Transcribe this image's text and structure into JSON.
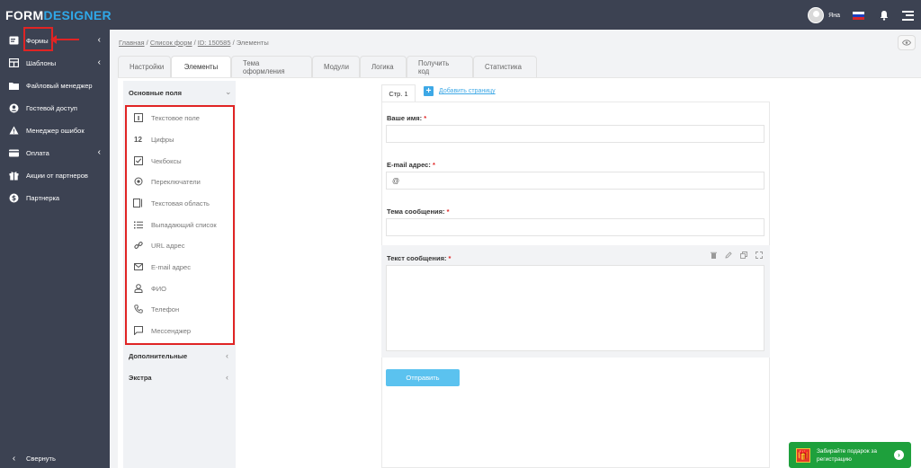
{
  "brand": {
    "logo_part1": "FORM",
    "logo_part2": "DESIGNER"
  },
  "header": {
    "username": "Яна",
    "flag_colors": [
      "#ffffff",
      "#1d3fbf",
      "#d8262b"
    ]
  },
  "sidebar": {
    "items": [
      {
        "label": "Формы",
        "icon": "forms-icon",
        "has_chevron": true
      },
      {
        "label": "Шаблоны",
        "icon": "templates-icon",
        "has_chevron": true
      },
      {
        "label": "Файловый менеджер",
        "icon": "folder-icon",
        "has_chevron": false
      },
      {
        "label": "Гостевой доступ",
        "icon": "user-circle-icon",
        "has_chevron": false
      },
      {
        "label": "Менеджер ошибок",
        "icon": "warning-icon",
        "has_chevron": false
      },
      {
        "label": "Оплата",
        "icon": "wallet-icon",
        "has_chevron": true
      },
      {
        "label": "Акции от партнеров",
        "icon": "gift-icon",
        "has_chevron": false
      },
      {
        "label": "Партнерка",
        "icon": "dollar-icon",
        "has_chevron": false
      }
    ],
    "collapse_label": "Свернуть"
  },
  "breadcrumb": {
    "home": "Главная",
    "sep1": " / ",
    "forms": "Список форм",
    "sep2": " / ",
    "id": "ID: 150585",
    "sep3": " / ",
    "current": "Элементы"
  },
  "tabs": [
    "Настройки",
    "Элементы",
    "Тема оформления",
    "Модули",
    "Логика",
    "Получить код",
    "Статистика"
  ],
  "palette": {
    "main_section": "Основные поля",
    "fields": [
      {
        "label": "Текстовое поле",
        "icon": "text-field-icon"
      },
      {
        "label": "Цифры",
        "icon": "numbers-icon",
        "glyph": "12"
      },
      {
        "label": "Чекбоксы",
        "icon": "checkbox-icon"
      },
      {
        "label": "Переключатели",
        "icon": "radio-icon"
      },
      {
        "label": "Текстовая область",
        "icon": "textarea-icon"
      },
      {
        "label": "Выпадающий список",
        "icon": "list-icon"
      },
      {
        "label": "URL адрес",
        "icon": "link-icon"
      },
      {
        "label": "E-mail адрес",
        "icon": "mail-icon"
      },
      {
        "label": "ФИО",
        "icon": "person-icon"
      },
      {
        "label": "Телефон",
        "icon": "phone-icon"
      },
      {
        "label": "Мессенджер",
        "icon": "message-icon"
      }
    ],
    "extra_sections": [
      "Дополнительные",
      "Экстра"
    ]
  },
  "form": {
    "page_tab": "Стр. 1",
    "add_page": "Добавить страницу",
    "fields": [
      {
        "label": "Ваше имя:",
        "required": "*",
        "value": ""
      },
      {
        "label": "E-mail адрес:",
        "required": "*",
        "value": "@"
      },
      {
        "label": "Тема сообщения:",
        "required": "*",
        "value": ""
      }
    ],
    "textarea_label": "Текст сообщения:",
    "textarea_required": "*",
    "submit": "Отправить"
  },
  "promo": {
    "text": "Забирайте подарок за регистрацию"
  },
  "colors": {
    "sidebar_bg": "#3c4252",
    "accent": "#2fa8e8",
    "highlight": "#e02424",
    "promo": "#1ea03c"
  }
}
